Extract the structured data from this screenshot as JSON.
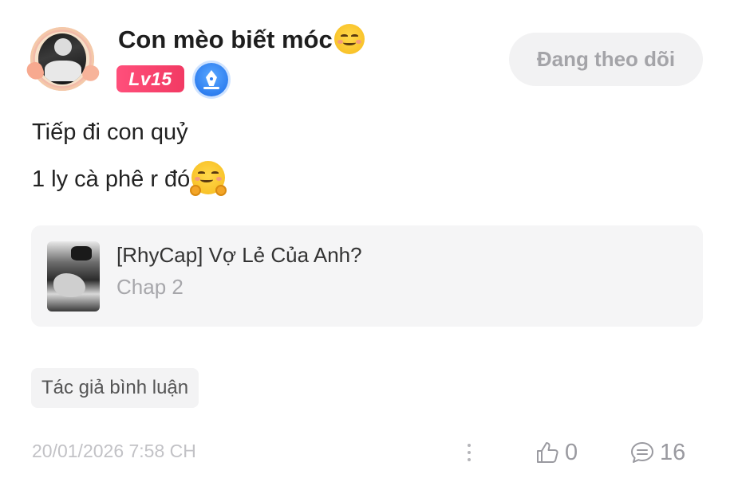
{
  "user": {
    "name": "Con mèo biết móc",
    "name_emoji": "smiling-face-emoji",
    "level": "Lv15",
    "level_color": "#f23a63",
    "verified_icon": "pen-badge-icon",
    "verified_color": "#2f7ff0"
  },
  "follow": {
    "label": "Đang theo dõi"
  },
  "comment": {
    "lines": [
      "Tiếp đi con quỷ",
      "1 ly cà phê r đó"
    ],
    "line2_emoji": "hugging-face-emoji"
  },
  "chapter": {
    "title": "[RhyCap] Vợ Lẻ Của Anh?",
    "subtitle": "Chap 2"
  },
  "author_tag": "Tác giả bình luận",
  "meta": {
    "timestamp": "20/01/2026 7:58 CH",
    "likes": "0",
    "replies": "16",
    "more_icon": "more-vertical-icon",
    "like_icon": "thumbs-up-icon",
    "reply_icon": "comment-icon"
  }
}
